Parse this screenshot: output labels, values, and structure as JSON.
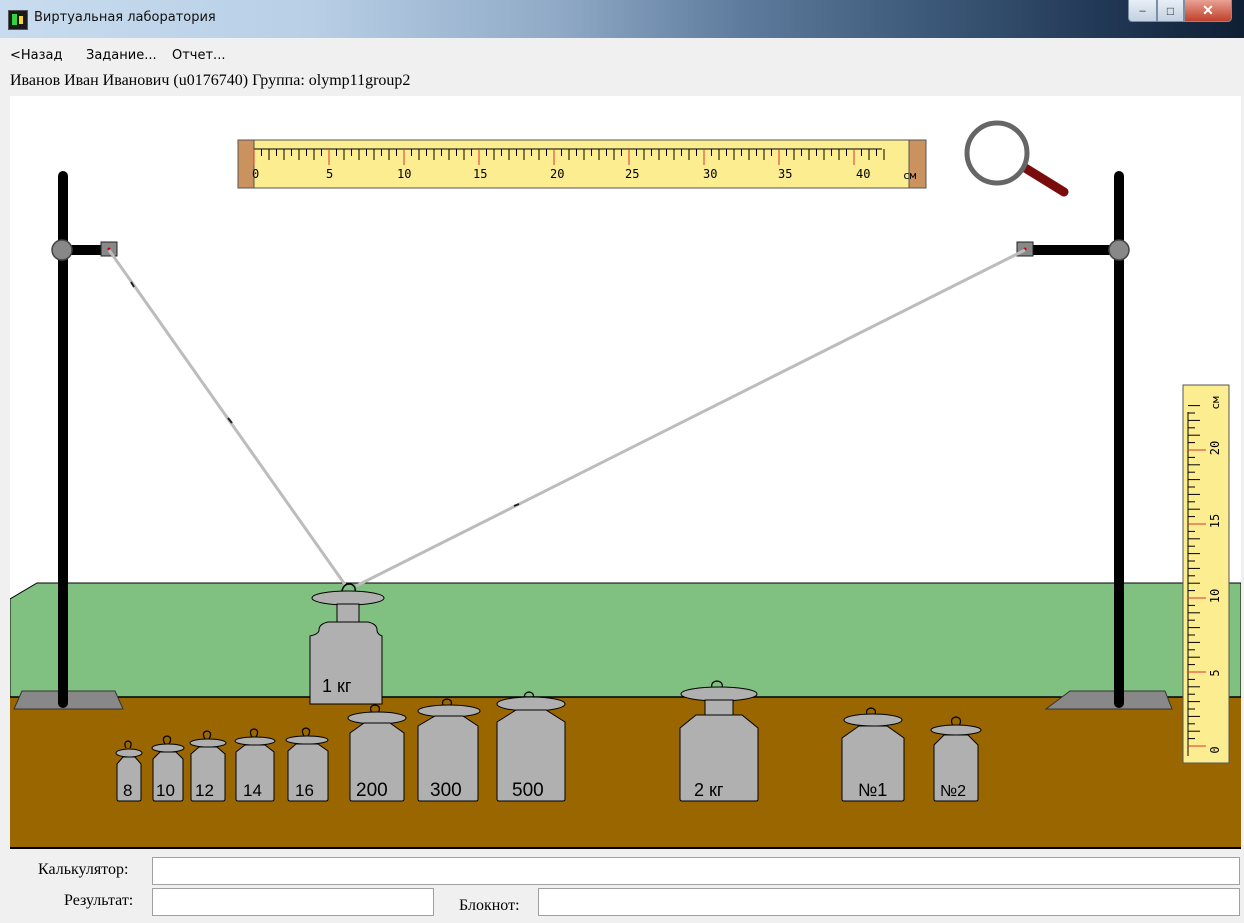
{
  "window": {
    "title": "Виртуальная лаборатория",
    "controls": {
      "minimize": "–",
      "maximize": "□",
      "close": "✕"
    }
  },
  "menu": {
    "back": "<Назад",
    "task": "Задание...",
    "report": "Отчет..."
  },
  "user_info": "Иванов Иван Иванович (u0176740)  Группа: olymp11group2",
  "ruler_horizontal": {
    "labels": [
      "0",
      "5",
      "10",
      "15",
      "20",
      "25",
      "30",
      "35",
      "40"
    ],
    "unit": "см"
  },
  "ruler_vertical": {
    "labels": [
      "0",
      "5",
      "10",
      "15",
      "20"
    ],
    "unit": "см"
  },
  "weights": {
    "w8": "8",
    "w10": "10",
    "w12": "12",
    "w14": "14",
    "w16": "16",
    "w200": "200",
    "w300": "300",
    "w500": "500",
    "w2kg": "2 кг",
    "wn1": "№1",
    "wn2": "№2",
    "hanging": "1 кг"
  },
  "bottom": {
    "calculator_label": "Калькулятор:",
    "result_label": "Результат:",
    "notepad_label": "Блокнот:",
    "calculator_value": "",
    "result_value": "",
    "notepad_value": ""
  },
  "colors": {
    "table_top": "#80c080",
    "table_front": "#996600",
    "ruler": "#fcee90",
    "weight": "#b0b0b0",
    "stand": "#000000"
  }
}
